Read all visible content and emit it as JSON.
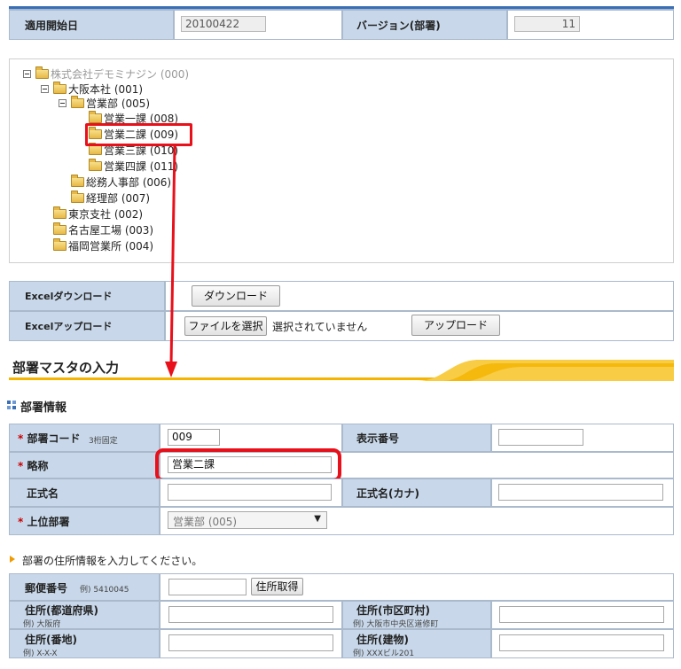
{
  "top_bar": {
    "effective_date_label": "適用開始日",
    "effective_date_value": "20100422",
    "version_label": "バージョン(部署)",
    "version_value": "11"
  },
  "tree": {
    "nodes": [
      {
        "label": "株式会社デモミナジン (000)"
      },
      {
        "label": "大阪本社 (001)"
      },
      {
        "label": "営業部 (005)"
      },
      {
        "label": "営業一課 (008)"
      },
      {
        "label": "営業二課 (009)"
      },
      {
        "label": "営業三課 (010)"
      },
      {
        "label": "営業四課 (011)"
      },
      {
        "label": "総務人事部 (006)"
      },
      {
        "label": "経理部 (007)"
      },
      {
        "label": "東京支社 (002)"
      },
      {
        "label": "名古屋工場 (003)"
      },
      {
        "label": "福岡営業所 (004)"
      }
    ]
  },
  "excel": {
    "download_label": "Excelダウンロード",
    "download_button": "ダウンロード",
    "upload_label": "Excelアップロード",
    "file_button": "ファイルを選択",
    "no_file_text": "選択されていません",
    "upload_button": "アップロード"
  },
  "section": {
    "title": "部署マスタの入力",
    "subsection": "部署情報"
  },
  "form": {
    "required_mark": "*",
    "dept_code_label": "部署コード",
    "dept_code_hint": "3桁固定",
    "dept_code_value": "009",
    "display_no_label": "表示番号",
    "display_no_value": "",
    "abbr_label": "略称",
    "abbr_value": "営業二課",
    "formal_name_label": "正式名",
    "formal_name_value": "",
    "formal_kana_label": "正式名(カナ)",
    "formal_kana_value": "",
    "parent_label": "上位部署",
    "parent_value": "営業部 (005)"
  },
  "address": {
    "note": "部署の住所情報を入力してください。",
    "zip_label": "郵便番号",
    "zip_hint": "例) 5410045",
    "zip_button": "住所取得",
    "pref_label": "住所(都道府県)",
    "pref_hint": "例) 大阪府",
    "city_label": "住所(市区町村)",
    "city_hint": "例) 大阪市中央区道修町",
    "street_label": "住所(番地)",
    "street_hint": "例) X-X-X",
    "building_label": "住所(建物)",
    "building_hint": "例) XXXビル201"
  },
  "colors": {
    "highlight": "#e8101a",
    "label_bg": "#c8d8ea",
    "accent_blue": "#3b6fb5",
    "header_orange": "#f4b400"
  }
}
